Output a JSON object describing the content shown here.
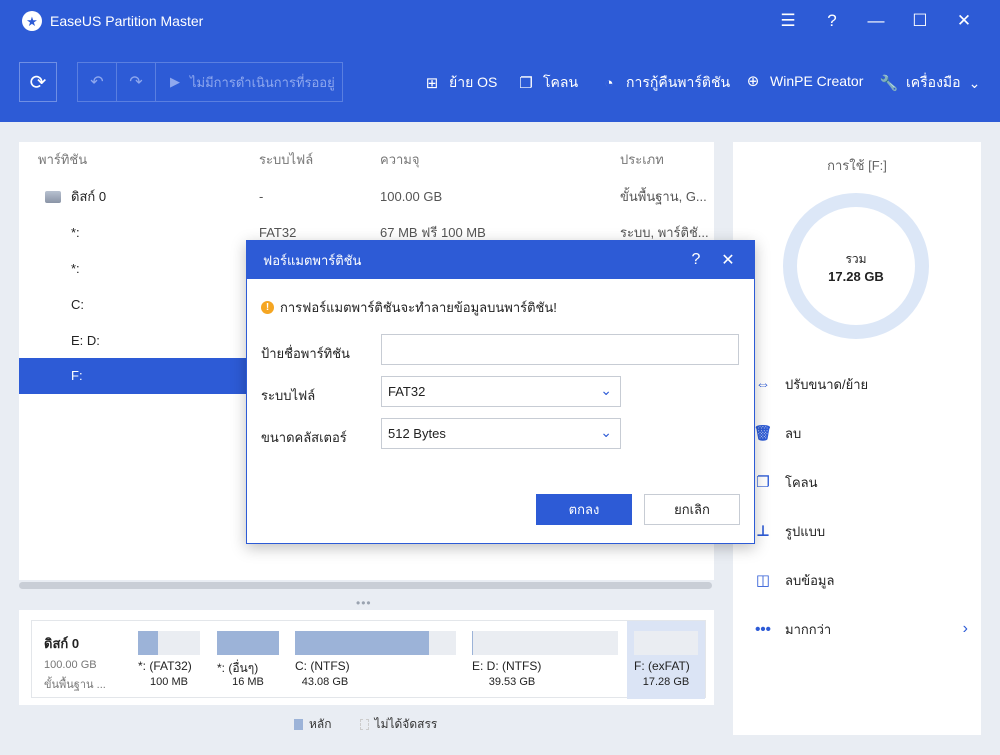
{
  "app": {
    "title": "EaseUS Partition Master"
  },
  "window_controls": {
    "menu": "☰",
    "help": "?",
    "minimize": "—",
    "maximize": "☐",
    "close": "✕"
  },
  "toolbar": {
    "pending_text": "ไม่มีการดำเนินการที่รออยู่",
    "migrate_os": "ย้าย OS",
    "clone": "โคลน",
    "recovery": "การกู้คืนพาร์ติชัน",
    "winpe": "WinPE Creator",
    "tools": "เครื่องมือ"
  },
  "table": {
    "headers": {
      "partition": "พาร์ทิชัน",
      "filesystem": "ระบบไฟล์",
      "capacity": "ความจุ",
      "type": "ประเภท"
    },
    "rows": [
      {
        "partition": "ดิสก์ 0",
        "filesystem": "-",
        "capacity": "100.00 GB",
        "type": "ขั้นพื้นฐาน, G..."
      },
      {
        "partition": "*:",
        "filesystem": "FAT32",
        "capacity": "67 MB ฟรี 100 MB",
        "type": "ระบบ, พาร์ติชั..."
      },
      {
        "partition": "*:",
        "filesystem": "",
        "capacity": "",
        "type": ""
      },
      {
        "partition": "C:",
        "filesystem": "",
        "capacity": "",
        "type": ""
      },
      {
        "partition": "E: D:",
        "filesystem": "",
        "capacity": "",
        "type": ""
      },
      {
        "partition": "F:",
        "filesystem": "",
        "capacity": "",
        "type": ""
      }
    ]
  },
  "disk_map": {
    "title": "ดิสก์ 0",
    "size": "100.00 GB",
    "type": "ขั้นพื้นฐาน ...",
    "segments": [
      {
        "label": "*: (FAT32)",
        "size": "100 MB",
        "used": 0.33
      },
      {
        "label": "*: (อื่นๆ)",
        "size": "16 MB",
        "used": 1.0
      },
      {
        "label": "C: (NTFS)",
        "size": "43.08 GB",
        "used": 0.83
      },
      {
        "label": "E: D: (NTFS)",
        "size": "39.53 GB",
        "used": 0.01
      },
      {
        "label": "F: (exFAT)",
        "size": "17.28 GB",
        "used": 0.0
      }
    ]
  },
  "legend": {
    "primary": "หลัก",
    "unallocated": "ไม่ได้จัดสรร"
  },
  "right_panel": {
    "usage_title": "การใช้ [F:]",
    "total_label": "รวม",
    "total_value": "17.28 GB",
    "actions": {
      "resize": "ปรับขนาด/ย้าย",
      "delete": "ลบ",
      "clone": "โคลน",
      "format": "รูปแบบ",
      "wipe": "ลบข้อมูล",
      "more": "มากกว่า"
    }
  },
  "dialog": {
    "title": "ฟอร์แมตพาร์ติชัน",
    "help": "?",
    "close": "✕",
    "warning": "การฟอร์แมตพาร์ติชันจะทำลายข้อมูลบนพาร์ติชัน!",
    "label_field": "ป้ายชื่อพาร์ทิชัน",
    "label_value": "",
    "filesystem_field": "ระบบไฟล์",
    "filesystem_value": "FAT32",
    "cluster_field": "ขนาดคลัสเตอร์",
    "cluster_value": "512 Bytes",
    "ok": "ตกลง",
    "cancel": "ยกเลิก"
  },
  "colors": {
    "accent": "#2d5bd6",
    "used": "#9cb3d8",
    "free": "#eaedf2",
    "warning": "#f5a623"
  }
}
